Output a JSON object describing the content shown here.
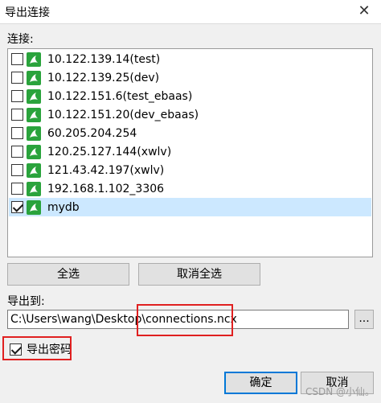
{
  "window": {
    "title": "导出连接",
    "close_glyph": "✕"
  },
  "connections_label": "连接:",
  "connections": [
    {
      "label": "10.122.139.14(test)",
      "checked": false,
      "selected": false
    },
    {
      "label": "10.122.139.25(dev)",
      "checked": false,
      "selected": false
    },
    {
      "label": "10.122.151.6(test_ebaas)",
      "checked": false,
      "selected": false
    },
    {
      "label": "10.122.151.20(dev_ebaas)",
      "checked": false,
      "selected": false
    },
    {
      "label": "60.205.204.254",
      "checked": false,
      "selected": false
    },
    {
      "label": "120.25.127.144(xwlv)",
      "checked": false,
      "selected": false
    },
    {
      "label": "121.43.42.197(xwlv)",
      "checked": false,
      "selected": false
    },
    {
      "label": "192.168.1.102_3306",
      "checked": false,
      "selected": false
    },
    {
      "label": "mydb",
      "checked": true,
      "selected": true
    }
  ],
  "buttons": {
    "select_all": "全选",
    "deselect_all": "取消全选",
    "browse": "...",
    "ok": "确定",
    "cancel": "取消"
  },
  "export_to_label": "导出到:",
  "export_path": "C:\\Users\\wang\\Desktop\\connections.ncx",
  "export_password": {
    "label": "导出密码",
    "checked": true
  },
  "watermark": "CSDN @小仙。",
  "colors": {
    "highlight": "#e02020",
    "selection": "#cce8ff",
    "mysql_icon": "#2aa33c"
  }
}
